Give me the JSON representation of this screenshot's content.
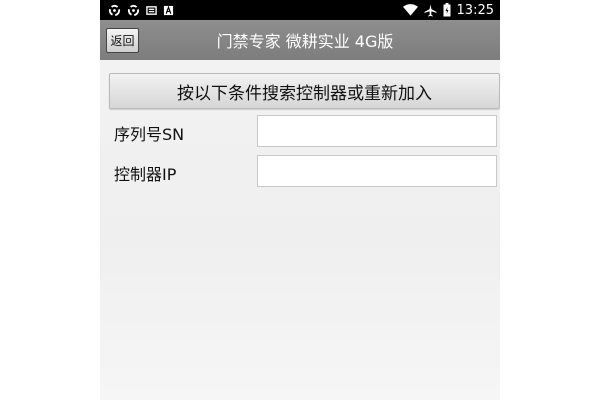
{
  "status_bar": {
    "time": "13:25",
    "left_icons": [
      "sync-icon",
      "sync-icon",
      "mail-icon",
      "font-icon"
    ],
    "right_icons": [
      "wifi-icon",
      "airplane-icon",
      "battery-icon"
    ]
  },
  "title_bar": {
    "back_label": "返回",
    "title": "门禁专家 微耕实业 4G版"
  },
  "search_button": {
    "label": "按以下条件搜索控制器或重新加入"
  },
  "fields": {
    "serial": {
      "label": "序列号SN",
      "value": ""
    },
    "ip": {
      "label": "控制器IP",
      "value": ""
    }
  },
  "colors": {
    "status_bar": "#000000",
    "title_bar": "#858585",
    "background": "#f2f2f2"
  }
}
